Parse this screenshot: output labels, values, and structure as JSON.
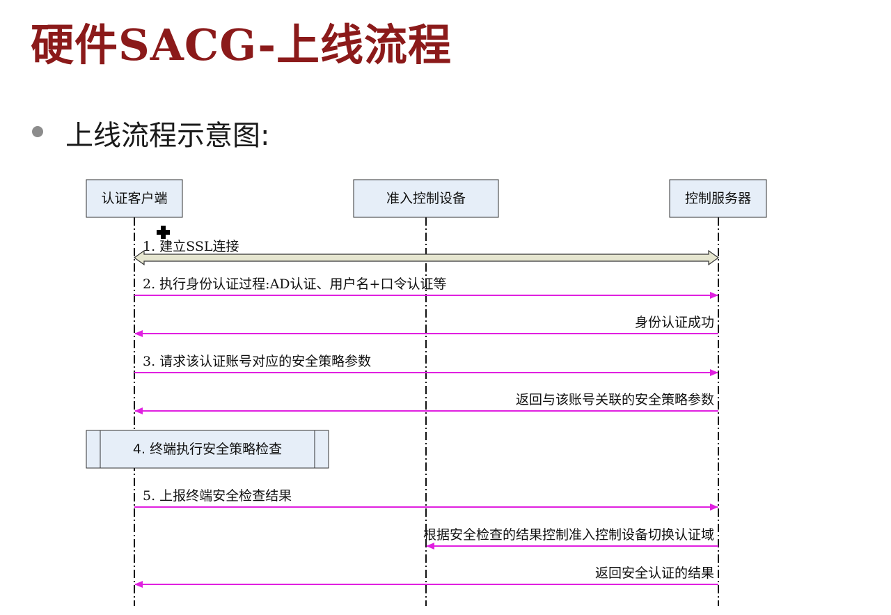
{
  "title": "硬件SACG-上线流程",
  "bullet": "上线流程示意图:",
  "participants": [
    "认证客户端",
    "准入控制设备",
    "控制服务器"
  ],
  "messages": [
    {
      "label": "1. 建立SSL连接",
      "from": 0,
      "to": 2,
      "style": "double"
    },
    {
      "label": "2. 执行身份认证过程:AD认证、用户名+口令认证等",
      "from": 0,
      "to": 2,
      "style": "magenta"
    },
    {
      "label": "身份认证成功",
      "from": 2,
      "to": 0,
      "style": "magenta"
    },
    {
      "label": "3. 请求该认证账号对应的安全策略参数",
      "from": 0,
      "to": 2,
      "style": "magenta"
    },
    {
      "label": "返回与该账号关联的安全策略参数",
      "from": 2,
      "to": 0,
      "style": "magenta"
    },
    {
      "label": "4. 终端执行安全策略检查",
      "style": "process"
    },
    {
      "label": "5. 上报终端安全检查结果",
      "from": 0,
      "to": 2,
      "style": "magenta"
    },
    {
      "label": "根据安全检查的结果控制准入控制设备切换认证域",
      "from": 2,
      "to": 1,
      "style": "magenta"
    },
    {
      "label": "返回安全认证的结果",
      "from": 2,
      "to": 0,
      "style": "magenta"
    }
  ],
  "colors": {
    "title": "#8B1A1A",
    "arrow": "#E020E0",
    "double_fill": "#E6E6D0"
  },
  "icons": {
    "cursor": "plus-cursor-icon"
  }
}
